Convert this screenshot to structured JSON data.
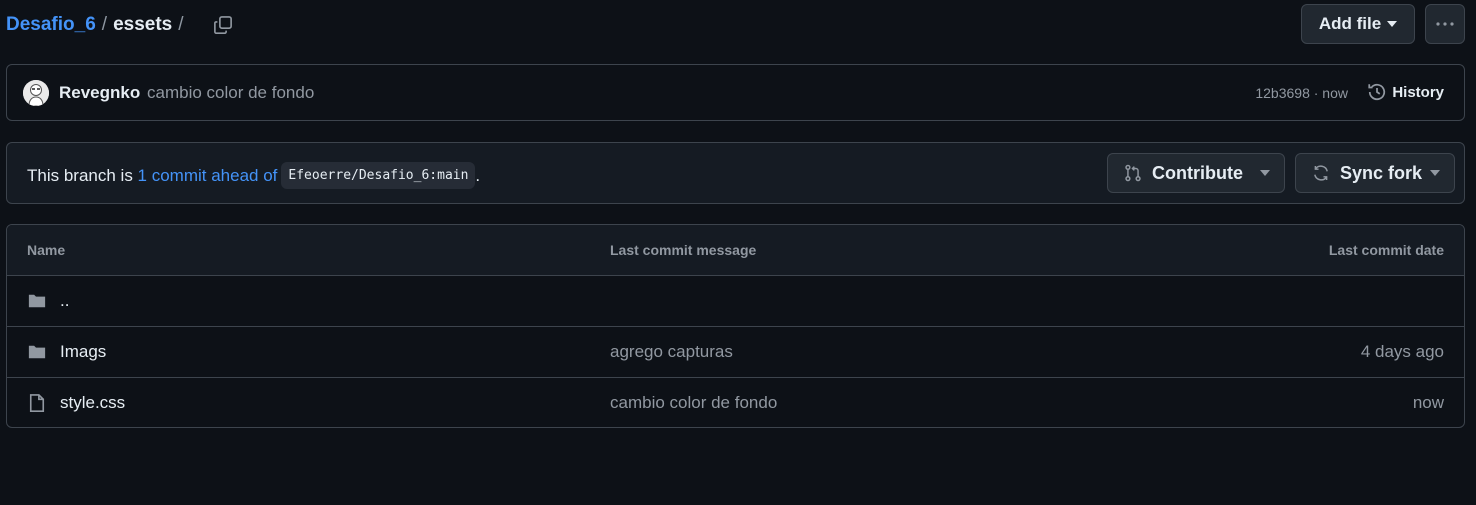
{
  "breadcrumb": {
    "repo": "Desafio_6",
    "sep1": "/",
    "folder": "essets",
    "sep2": "/"
  },
  "toolbar": {
    "add_file": "Add file"
  },
  "commit": {
    "author": "Revegnko",
    "message": "cambio color de fondo",
    "sha_time": "12b3698 · now",
    "history": "History"
  },
  "branch": {
    "prefix": "This branch is ",
    "ahead": "1 commit ahead of",
    "ref": "Efeoerre/Desafio_6:main",
    "suffix": ".",
    "contribute": "Contribute",
    "sync_fork": "Sync fork"
  },
  "table": {
    "headers": [
      "Name",
      "Last commit message",
      "Last commit date"
    ],
    "rows": [
      {
        "name": "..",
        "message": "",
        "date": "",
        "icon": "folder-icon"
      },
      {
        "name": "Imags",
        "message": "agrego capturas",
        "date": "4 days ago",
        "icon": "folder-icon"
      },
      {
        "name": "style.css",
        "message": "cambio color de fondo",
        "date": "now",
        "icon": "file-icon"
      }
    ]
  },
  "colors": {
    "background": "#0d1117",
    "accent_link": "#4493f8",
    "border": "#3d444d",
    "muted_text": "#9198a1"
  }
}
